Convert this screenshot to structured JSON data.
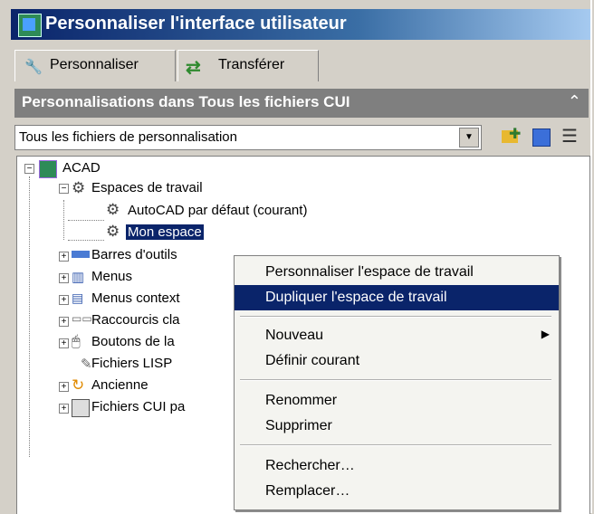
{
  "window": {
    "title": "Personnaliser l'interface utilisateur"
  },
  "tabs": [
    {
      "label": "Personnaliser"
    },
    {
      "label": "Transférer"
    }
  ],
  "panel": {
    "header": "Personnalisations dans Tous les fichiers CUI",
    "collapse_glyph": "⌃"
  },
  "filter": {
    "value": "Tous les fichiers de personnalisation"
  },
  "tree": {
    "root": "ACAD",
    "workspaces": "Espaces de travail",
    "ws_default": "AutoCAD par défaut (courant)",
    "ws_mine": "Mon espace",
    "items": [
      "Barres d'outils",
      "Menus",
      "Menus context",
      "Raccourcis cla",
      "Boutons de la",
      "Fichiers LISP",
      "Ancienne",
      "Fichiers CUI pa"
    ]
  },
  "context_menu": {
    "customize": "Personnaliser l'espace de travail",
    "duplicate": "Dupliquer l'espace de travail",
    "new": "Nouveau",
    "set_current": "Définir courant",
    "rename": "Renommer",
    "delete": "Supprimer",
    "find": "Rechercher…",
    "replace": "Remplacer…"
  }
}
